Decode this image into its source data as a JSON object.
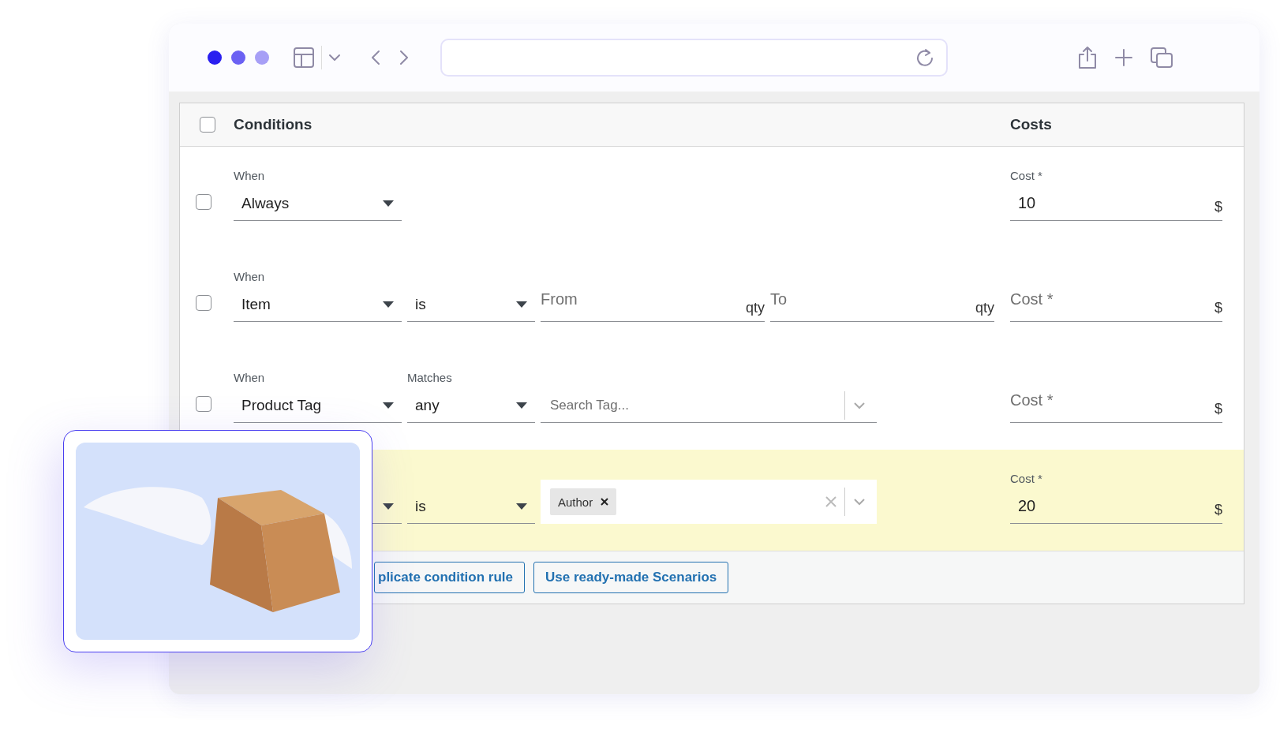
{
  "table": {
    "select_all": {
      "checked": false
    },
    "columns": [
      {
        "label": "Conditions"
      },
      {
        "label": "Costs"
      }
    ],
    "rows": [
      {
        "kind": "always",
        "checked": false,
        "highlighted": false,
        "when_label": "When",
        "when_value": "Always",
        "cost": {
          "label": "Cost *",
          "value": "10",
          "currency": "$"
        }
      },
      {
        "kind": "quantity",
        "checked": false,
        "highlighted": false,
        "when_label": "When",
        "when_value": "Item",
        "operator": "is",
        "from": {
          "placeholder": "From",
          "unit": "qty"
        },
        "to": {
          "placeholder": "To",
          "unit": "qty"
        },
        "cost": {
          "placeholder": "Cost *",
          "currency": "$"
        }
      },
      {
        "kind": "tag_search",
        "checked": false,
        "highlighted": false,
        "when_label": "When",
        "when_value": "Product Tag",
        "matches_label": "Matches",
        "matches_value": "any",
        "search": {
          "placeholder": "Search Tag..."
        },
        "cost": {
          "placeholder": "Cost *",
          "currency": "$"
        }
      },
      {
        "kind": "tag_selected",
        "highlighted": true,
        "operator": "is",
        "tags": [
          "Author"
        ],
        "cost": {
          "label": "Cost *",
          "value": "20",
          "currency": "$"
        }
      }
    ],
    "buttons": [
      {
        "label": "plicate condition rule"
      },
      {
        "label": "Use ready-made Scenarios"
      }
    ]
  }
}
